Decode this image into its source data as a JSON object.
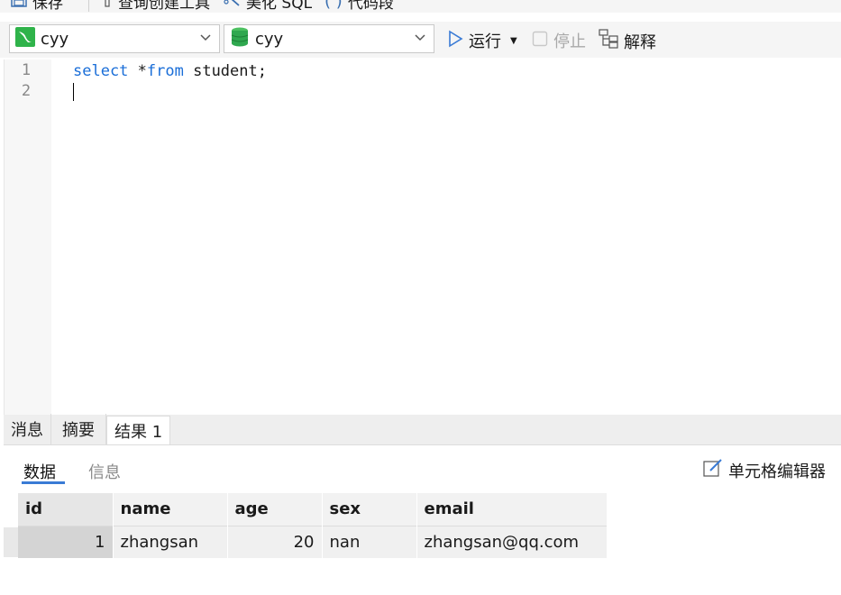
{
  "toolbar": {
    "save_label": "保存",
    "query_builder_label": "查询创建工具",
    "beautify_label": "美化 SQL",
    "snippet_label": "代码段"
  },
  "selectors": {
    "connection_value": "cyy",
    "database_value": "cyy"
  },
  "actions": {
    "run_label": "运行",
    "stop_label": "停止",
    "explain_label": "解释"
  },
  "editor": {
    "line_numbers": [
      "1",
      "2"
    ],
    "code_keyword1": "select",
    "code_mid": " *",
    "code_keyword2": "from",
    "code_rest": " student;"
  },
  "bottom_tabs": [
    "消息",
    "摘要",
    "结果 1"
  ],
  "result_tabs": {
    "data_label": "数据",
    "info_label": "信息",
    "cell_editor_label": "单元格编辑器"
  },
  "grid": {
    "columns": [
      "id",
      "name",
      "age",
      "sex",
      "email"
    ],
    "rows": [
      [
        "1",
        "zhangsan",
        "20",
        "nan",
        "zhangsan@qq.com"
      ]
    ]
  },
  "colors": {
    "keyword": "#1a6ed8",
    "accent_underline": "#3a7bd5",
    "run_icon": "#3a7bd5",
    "db_icon": "#2fa84f"
  }
}
